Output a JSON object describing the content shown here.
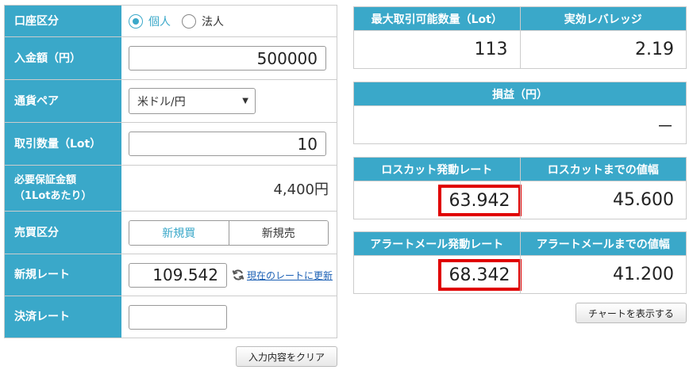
{
  "form": {
    "account_type": {
      "label": "口座区分",
      "options": [
        "個人",
        "法人"
      ],
      "selected": "個人"
    },
    "deposit": {
      "label": "入金額（円）",
      "value": "500000"
    },
    "currency_pair": {
      "label": "通貨ペア",
      "value": "米ドル/円"
    },
    "lot": {
      "label": "取引数量（Lot）",
      "value": "10"
    },
    "margin": {
      "label_line1": "必要保証金額",
      "label_line2": "（1Lotあたり）",
      "value": "4,400円"
    },
    "trade_side": {
      "label": "売買区分",
      "buy": "新規買",
      "sell": "新規売",
      "selected": "新規買"
    },
    "new_rate": {
      "label": "新規レート",
      "value": "109.542",
      "refresh_label": "現在のレートに更新"
    },
    "close_rate": {
      "label": "決済レート",
      "value": ""
    },
    "clear_button": "入力内容をクリア"
  },
  "results": {
    "max_lot": {
      "label": "最大取引可能数量（Lot）",
      "value": "113"
    },
    "leverage": {
      "label": "実効レバレッジ",
      "value": "2.19"
    },
    "pnl": {
      "label": "損益（円）",
      "value": "－"
    },
    "losscut_rate": {
      "label": "ロスカット発動レート",
      "value": "63.942"
    },
    "losscut_range": {
      "label": "ロスカットまでの値幅",
      "value": "45.600"
    },
    "alert_rate": {
      "label": "アラートメール発動レート",
      "value": "68.342"
    },
    "alert_range": {
      "label": "アラートメールまでの値幅",
      "value": "41.200"
    },
    "chart_button": "チャートを表示する"
  },
  "colors": {
    "header": "#3aa8c9",
    "highlight": "#e00000"
  }
}
